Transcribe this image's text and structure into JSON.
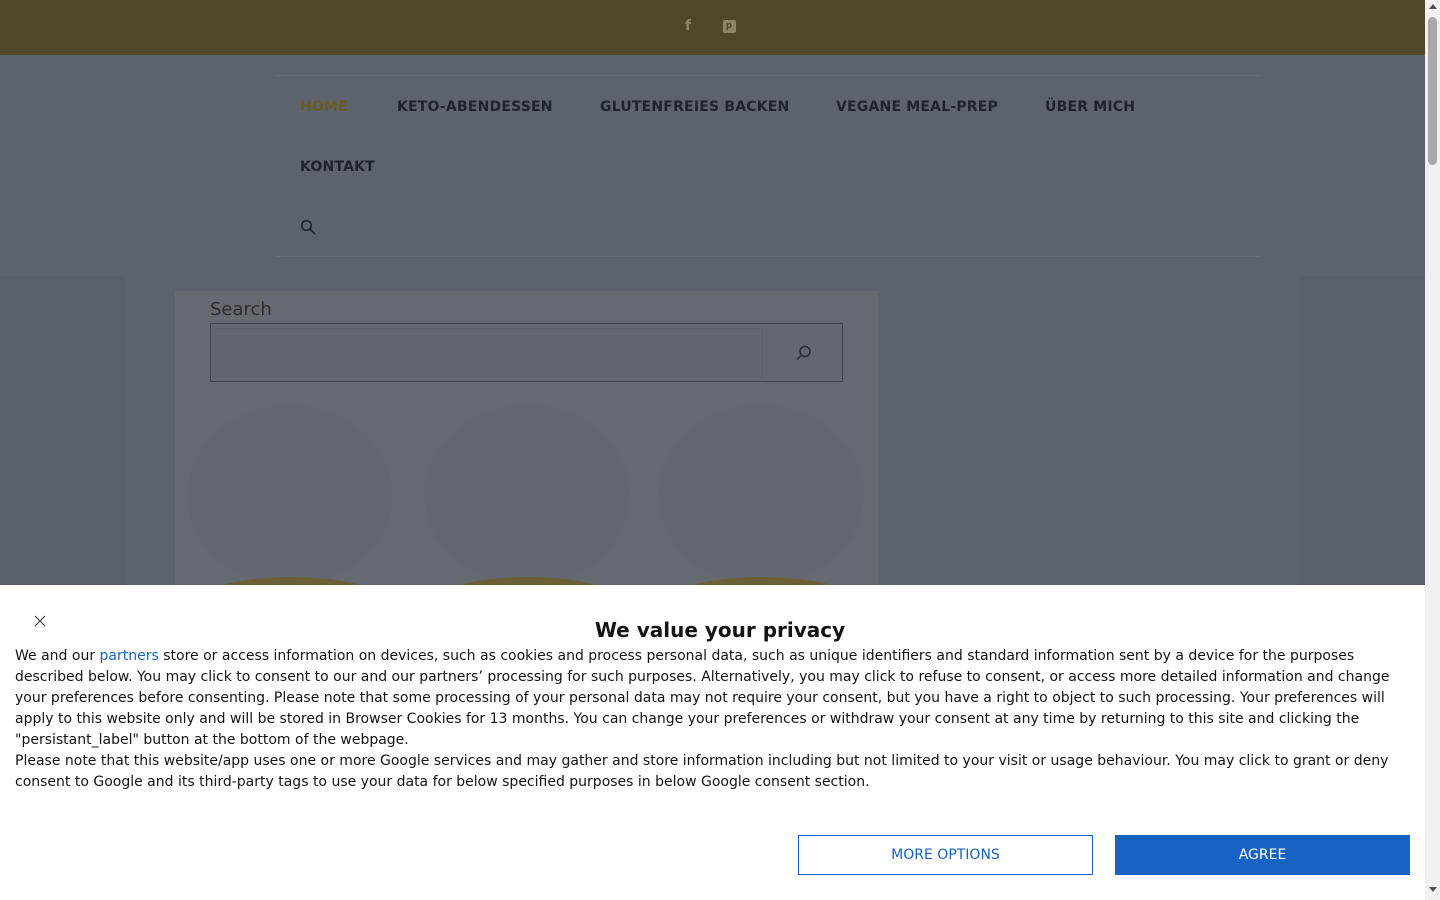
{
  "social": {
    "facebook_glyph": "f",
    "pinterest_glyph": "p",
    "facebook_icon": "facebook-icon",
    "pinterest_icon": "pinterest-icon"
  },
  "nav": {
    "items": [
      {
        "label": "HOME",
        "active": true
      },
      {
        "label": "KETO-ABENDESSEN",
        "active": false
      },
      {
        "label": "GLUTENFREIES BACKEN",
        "active": false
      },
      {
        "label": "VEGANE MEAL-PREP",
        "active": false
      },
      {
        "label": "ÜBER MICH",
        "active": false
      },
      {
        "label": "KONTAKT",
        "active": false
      }
    ],
    "search_icon": "search-icon"
  },
  "search": {
    "label": "Search",
    "placeholder": "",
    "value": ""
  },
  "consent": {
    "title": "We value your privacy",
    "text_before_link": "We and our ",
    "link_label": "partners",
    "text_after_link": " store or access information on devices, such as cookies and process personal data, such as unique identifiers and standard information sent by a device for the purposes described below. You may click to consent to our and our partners’ processing for such purposes. Alternatively, you may click to refuse to consent, or access more detailed information and change your preferences before consenting. Please note that some processing of your personal data may not require your consent, but you have a right to object to such processing. Your preferences will apply to this website only and will be stored in Browser Cookies for 13 months. You can change your preferences or withdraw your consent at any time by returning to this site and clicking the \"persistant_label\" button at the bottom of the webpage.",
    "google_text": "Please note that this website/app uses one or more Google services and may gather and store information including but not limited to your visit or usage behaviour. You may click to grant or deny consent to Google and its third-party tags to use your data for below specified purposes in below Google consent section.",
    "more_options_label": "MORE OPTIONS",
    "agree_label": "AGREE"
  },
  "colors": {
    "topbar": "#50472b",
    "accent": "#1863c2",
    "nav_active": "#6b5a24",
    "overlay": "#5d636c"
  }
}
